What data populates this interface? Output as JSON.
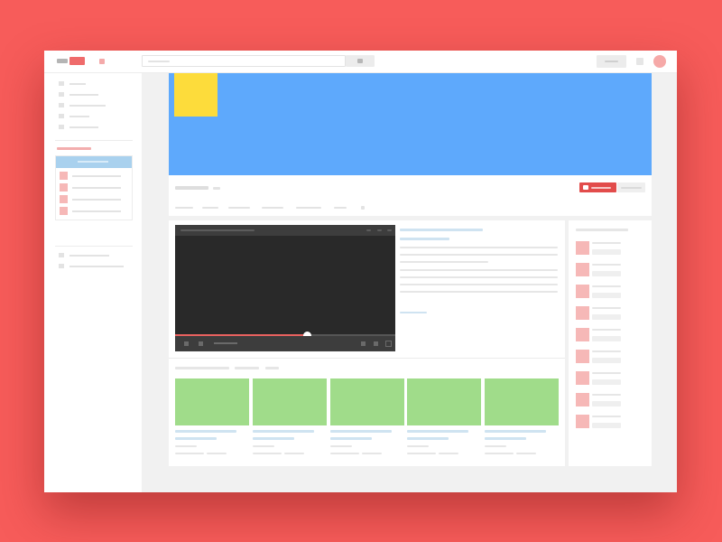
{
  "colors": {
    "page_background": "#f75c5a",
    "banner": "#5ea9fc",
    "channel_avatar": "#fddc3b",
    "accent": "#e24c4b",
    "video_thumbnail": "#a0dc8a",
    "subscription_highlight": "#a9d1ee",
    "player_background": "#292929",
    "progress": "#e8615f"
  },
  "player": {
    "progress": 0.6
  },
  "sidebar": {
    "nav_item_count": 5,
    "subscription_item_count": 4,
    "footer_item_count": 2
  },
  "channel": {
    "tab_count": 7
  },
  "video_grid": {
    "item_count": 5
  },
  "related_list": {
    "item_count": 9
  },
  "icons": [
    "logo-icon",
    "upload-icon",
    "search-icon",
    "apps-icon",
    "play-icon",
    "volume-icon",
    "settings-icon",
    "fullscreen-icon",
    "subscribe-icon"
  ]
}
